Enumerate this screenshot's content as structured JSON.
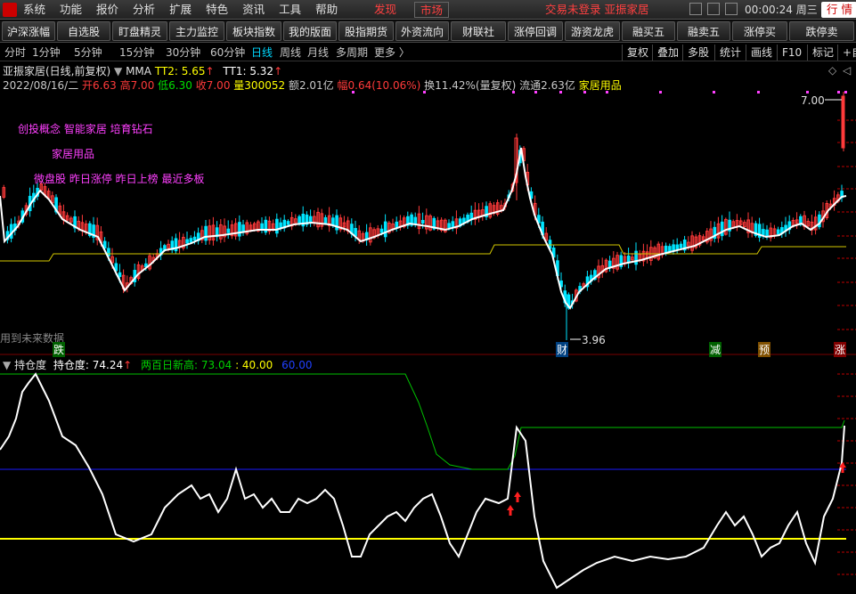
{
  "menubar": {
    "items": [
      "系统",
      "功能",
      "报价",
      "分析",
      "扩展",
      "特色",
      "资讯",
      "工具",
      "帮助"
    ],
    "discover": "发现",
    "market": "市场",
    "login_status": "交易未登录  亚振家居",
    "clock": "00:00:24 周三",
    "hang": "行 情"
  },
  "toolbar": {
    "buttons": [
      "沪深涨幅",
      "自选股",
      "盯盘精灵",
      "主力监控",
      "板块指数",
      "我的版面",
      "股指期货",
      "外资流向",
      "财联社",
      "涨停回调",
      "游资龙虎",
      "融买五",
      "融卖五",
      "涨停买",
      "跌停卖"
    ]
  },
  "periods": {
    "items": [
      "分时",
      "1分钟",
      "5分钟",
      "15分钟",
      "30分钟",
      "60分钟",
      "日线",
      "周线",
      "月线",
      "多周期",
      "更多 〉"
    ],
    "active": "日线",
    "tools": [
      "复权",
      "叠加",
      "多股",
      "统计",
      "画线",
      "F10",
      "标记",
      "+自"
    ]
  },
  "stock": {
    "title": "亚振家居(日线,前复权)",
    "mma_label": "MMA",
    "tt2": "TT2: 5.65",
    "tt1": "TT1: 5.32",
    "date": "2022/08/16/二",
    "open": "开6.63",
    "high": "高7.00",
    "low": "低6.30",
    "close": "收7.00",
    "volume": "量300052",
    "amount": "额2.01亿",
    "change": "幅0.64(10.06%)",
    "turnover": "换11.42%(量复权)",
    "float": "流通2.63亿",
    "sector": "家居用品"
  },
  "annotations": {
    "line1": "创投概念 智能家居 培育钻石",
    "line2": "家居用品",
    "line3": "微盘股 昨日涨停 昨日上榜 最近多板",
    "future_data": "用到未来数据",
    "high_price": "7.00",
    "low_price": "3.96",
    "marker_die": "跌",
    "marker_cai": "财",
    "marker_jian": "减",
    "marker_yu": "预",
    "marker_zhang": "涨"
  },
  "indicator": {
    "name": "持仓度",
    "value_label": "持仓度: 74.24",
    "high100_label": "两百日新高: 73.04",
    "level1_label": ": 40.00",
    "level2_label": "60.00"
  },
  "colors": {
    "up": "#ff3a3a",
    "down": "#00e5ff",
    "ma_white": "#ffffff",
    "ma_yellow": "#d4c800",
    "magenta": "#ff40ff",
    "green": "#00c000",
    "blue": "#0000ff",
    "yellow_line": "#ffff00"
  }
}
